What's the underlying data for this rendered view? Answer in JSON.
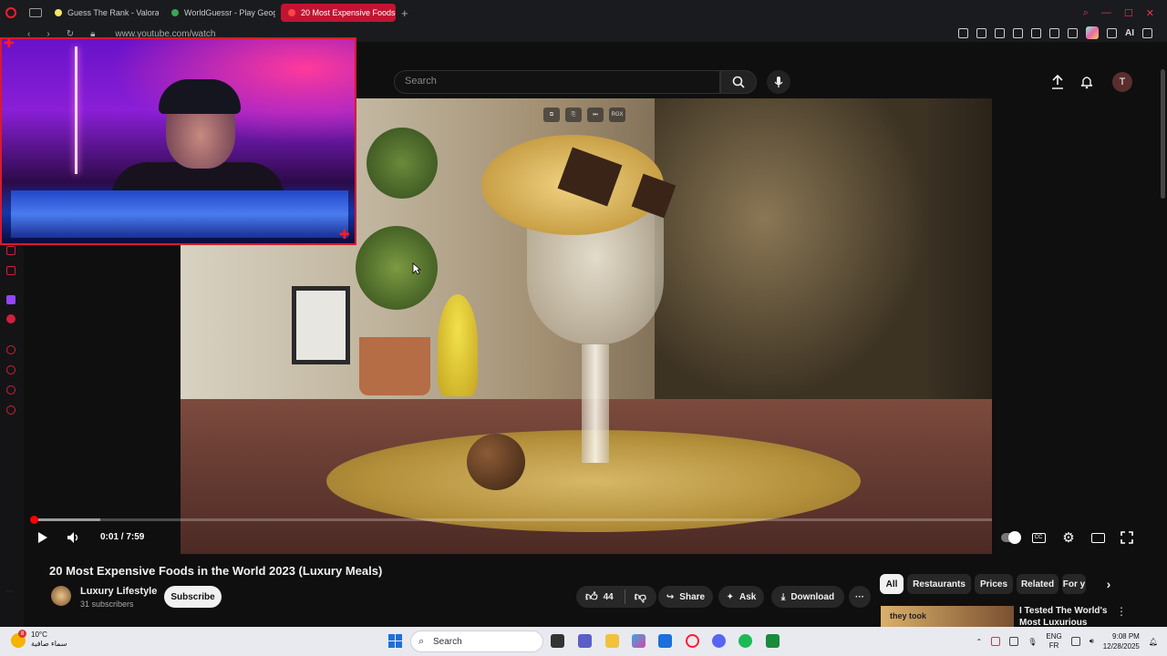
{
  "browser": {
    "tabs": [
      {
        "label": "Guess The Rank - Valorant",
        "active": false,
        "favicon_color": "#f5e663"
      },
      {
        "label": "WorldGuessr - Play Geography",
        "active": false,
        "favicon_color": "#3aa356"
      },
      {
        "label": "20 Most Expensive Foods",
        "active": true,
        "favicon_color": "#ff4444"
      }
    ],
    "new_tab": "+",
    "url": "www.youtube.com/watch",
    "ai_label": "AI"
  },
  "youtube": {
    "search_placeholder": "Search",
    "avatar_letter": "T",
    "player": {
      "time": "0:01 / 7:59",
      "progress_fraction": 0.001,
      "overlay_badge": "RGX"
    },
    "video_title": "20 Most Expensive Foods in the World 2023 (Luxury Meals)",
    "channel": {
      "name": "Luxury Lifestyle",
      "subscribers": "31 subscribers",
      "subscribe_label": "Subscribe"
    },
    "actions": {
      "likes": "44",
      "share": "Share",
      "ask": "Ask",
      "download": "Download"
    },
    "chips": [
      "All",
      "Restaurants",
      "Prices",
      "Related",
      "For y"
    ],
    "recommendation": {
      "title": "I Tested The World's Most Luxurious",
      "thumb_text": "they took"
    }
  },
  "taskbar": {
    "weather_temp": "10°C",
    "weather_desc": "سماء صافية",
    "weather_badge": "8",
    "search_label": "Search",
    "lang_top": "ENG",
    "lang_bottom": "FR",
    "time": "9:08 PM",
    "date": "12/28/2025"
  },
  "colors": {
    "accent": "#ff0000",
    "opera": "#ff1b2d",
    "cam_border": "#d81a2c"
  }
}
